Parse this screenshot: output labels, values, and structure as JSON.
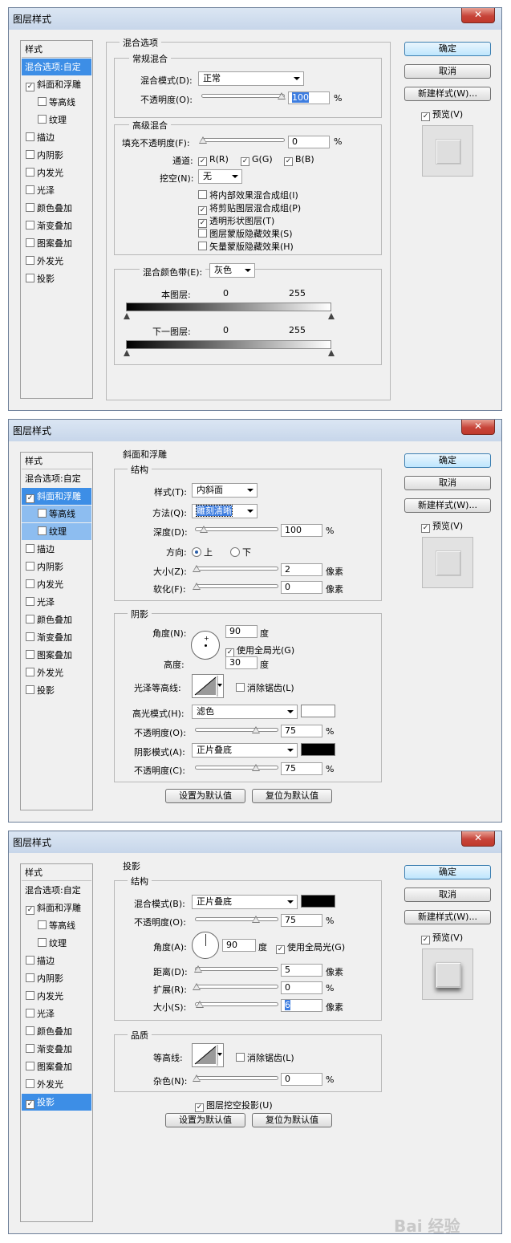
{
  "dialog_title": "图层样式",
  "close_glyph": "✕",
  "buttons": {
    "ok": "确定",
    "cancel": "取消",
    "new_style": "新建样式(W)...",
    "preview": "预览(V)",
    "set_default": "设置为默认值",
    "reset_default": "复位为默认值"
  },
  "styles": {
    "header": "样式",
    "blend_options": "混合选项:自定",
    "bevel": "斜面和浮雕",
    "contour": "等高线",
    "texture": "纹理",
    "stroke": "描边",
    "inner_shadow": "内阴影",
    "inner_glow": "内发光",
    "satin": "光泽",
    "color_overlay": "颜色叠加",
    "gradient_overlay": "渐变叠加",
    "pattern_overlay": "图案叠加",
    "outer_glow": "外发光",
    "drop_shadow": "投影"
  },
  "panel1": {
    "title": "混合选项",
    "general": "常规混合",
    "blend_mode_label": "混合模式(D):",
    "blend_mode": "正常",
    "opacity_label": "不透明度(O):",
    "opacity": "100",
    "advanced": "高级混合",
    "fill_opacity_label": "填充不透明度(F):",
    "fill_opacity": "0",
    "channels_label": "通道:",
    "ch_r": "R(R)",
    "ch_g": "G(G)",
    "ch_b": "B(B)",
    "knockout_label": "挖空(N):",
    "knockout": "无",
    "opt1": "将内部效果混合成组(I)",
    "opt2": "将剪贴图层混合成组(P)",
    "opt3": "透明形状图层(T)",
    "opt4": "图层蒙版隐藏效果(S)",
    "opt5": "矢量蒙版隐藏效果(H)",
    "band_label": "混合颜色带(E):",
    "band": "灰色",
    "this_layer": "本图层:",
    "under_layer": "下一图层:",
    "v0": "0",
    "v255": "255"
  },
  "panel2": {
    "title": "斜面和浮雕",
    "structure": "结构",
    "style_label": "样式(T):",
    "style": "内斜面",
    "technique_label": "方法(Q):",
    "technique": "雕刻清晰",
    "depth_label": "深度(D):",
    "depth": "100",
    "direction_label": "方向:",
    "dir_up": "上",
    "dir_down": "下",
    "size_label": "大小(Z):",
    "size": "2",
    "soften_label": "软化(F):",
    "soften": "0",
    "shading": "阴影",
    "angle_label": "角度(N):",
    "angle": "90",
    "degree": "度",
    "global_light": "使用全局光(G)",
    "altitude_label": "高度:",
    "altitude": "30",
    "gloss_label": "光泽等高线:",
    "anti_alias": "消除锯齿(L)",
    "highlight_label": "高光模式(H):",
    "highlight_mode": "滤色",
    "hl_opacity_label": "不透明度(O):",
    "hl_opacity": "75",
    "shadow_label": "阴影模式(A):",
    "shadow_mode": "正片叠底",
    "sh_opacity_label": "不透明度(C):",
    "sh_opacity": "75",
    "pixel": "像素",
    "percent": "%",
    "highlight_color": "#ffffff",
    "shadow_color": "#000000"
  },
  "panel3": {
    "title": "投影",
    "structure": "结构",
    "blend_label": "混合模式(B):",
    "blend_mode": "正片叠底",
    "opacity_label": "不透明度(O):",
    "opacity": "75",
    "angle_label": "角度(A):",
    "angle": "90",
    "degree": "度",
    "global_light": "使用全局光(G)",
    "distance_label": "距离(D):",
    "distance": "5",
    "spread_label": "扩展(R):",
    "spread": "0",
    "size_label": "大小(S):",
    "size": "6",
    "pixel": "像素",
    "percent": "%",
    "quality": "品质",
    "contour_label": "等高线:",
    "anti_alias": "消除锯齿(L)",
    "noise_label": "杂色(N):",
    "noise": "0",
    "knockout": "图层挖空投影(U)",
    "shadow_color": "#000000"
  },
  "check": "✓",
  "watermark": "Bai 经验"
}
